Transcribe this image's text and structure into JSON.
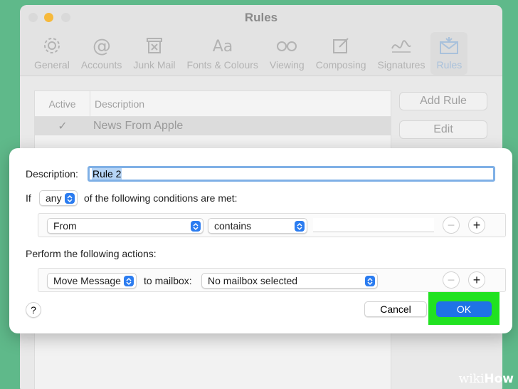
{
  "window": {
    "title": "Rules"
  },
  "toolbar": {
    "items": [
      {
        "label": "General",
        "icon": "gear-icon"
      },
      {
        "label": "Accounts",
        "icon": "at-icon"
      },
      {
        "label": "Junk Mail",
        "icon": "trash-x-icon"
      },
      {
        "label": "Fonts & Colours",
        "icon": "fonts-icon"
      },
      {
        "label": "Viewing",
        "icon": "glasses-icon"
      },
      {
        "label": "Composing",
        "icon": "compose-icon"
      },
      {
        "label": "Signatures",
        "icon": "signature-icon"
      },
      {
        "label": "Rules",
        "icon": "rules-envelope-icon",
        "active": true
      }
    ]
  },
  "rules_table": {
    "columns": [
      "Active",
      "Description"
    ],
    "rows": [
      {
        "active": "✓",
        "description": "News From Apple"
      }
    ]
  },
  "side_buttons": {
    "add_rule": "Add Rule",
    "edit": "Edit"
  },
  "dialog": {
    "description_label": "Description:",
    "description_value": "Rule 2",
    "if_label": "If",
    "any_value": "any",
    "conditions_suffix": "of the following conditions are met:",
    "condition": {
      "field": "From",
      "operator": "contains",
      "value": ""
    },
    "actions_label": "Perform the following actions:",
    "action": {
      "type": "Move Message",
      "to_label": "to mailbox:",
      "mailbox": "No mailbox selected"
    },
    "minus_symbol": "−",
    "plus_symbol": "+",
    "help": "?",
    "cancel": "Cancel",
    "ok": "OK"
  },
  "watermark": {
    "prefix": "wiki",
    "suffix": "How"
  },
  "colors": {
    "accent": "#1f73e6",
    "highlight": "#21e221",
    "background": "#5fb98a"
  }
}
